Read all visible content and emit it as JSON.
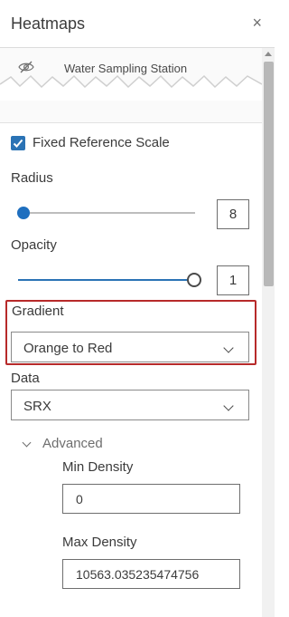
{
  "panel": {
    "title": "Heatmaps",
    "close_label": "×"
  },
  "layer": {
    "name": "Water Sampling Station"
  },
  "fixed_reference_scale": {
    "label": "Fixed Reference Scale",
    "checked": true
  },
  "radius": {
    "label": "Radius",
    "value": "8",
    "slider_fraction": 0.0
  },
  "opacity": {
    "label": "Opacity",
    "value": "1",
    "slider_fraction": 1.0
  },
  "gradient": {
    "label": "Gradient",
    "selected": "Orange to Red"
  },
  "data_field": {
    "label": "Data",
    "selected": "SRX"
  },
  "advanced": {
    "label": "Advanced",
    "min_density": {
      "label": "Min Density",
      "value": "0"
    },
    "max_density": {
      "label": "Max Density",
      "value": "10563.035235474756"
    }
  },
  "colors": {
    "accent": "#2b73b5",
    "highlight_border": "#b72a2a"
  },
  "icons": {
    "layer_visibility": "eye-hidden-icon",
    "close": "close-icon",
    "dropdown": "chevron-down-icon"
  }
}
